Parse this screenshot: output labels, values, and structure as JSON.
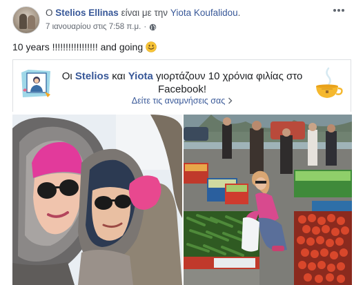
{
  "post": {
    "author": "Stelios Ellinas",
    "with_text": "είναι με την",
    "tagged": "Yiota Koufalidou",
    "period": ".",
    "timestamp": "7 ιανουαρίου στις 7:58 π.μ.",
    "separator": "·",
    "privacy_icon": "globe-icon",
    "more_icon": "more-options-icon",
    "text": "10 years !!!!!!!!!!!!!!!!! and going",
    "emoji": "smiley-emoji"
  },
  "card": {
    "prefix": "Οι",
    "name1": "Stelios",
    "conj": "και",
    "name2": "Yiota",
    "suffix": "γιορτάζουν 10 χρόνια φιλίας στο Facebook!",
    "link": "Δείτε τις αναμνήσεις σας",
    "link_icon": "chevron-right-icon"
  },
  "colors": {
    "link_blue": "#385898",
    "secondary_text": "#616770",
    "primary_text": "#1c1e21",
    "border": "#dddfe2"
  }
}
